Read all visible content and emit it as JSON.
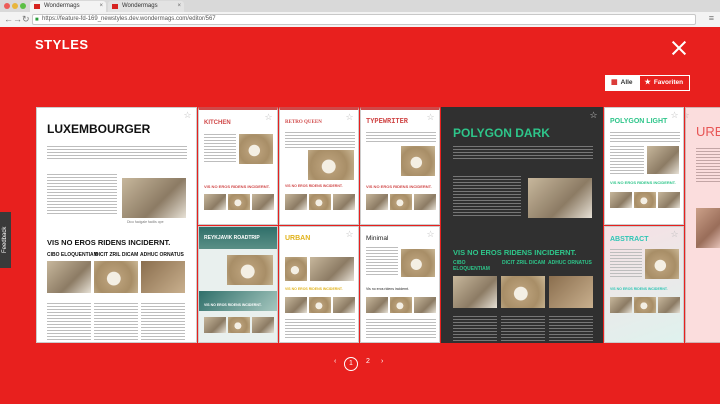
{
  "browser": {
    "tabs": [
      {
        "label": "Wondermags"
      },
      {
        "label": "Wondermags"
      }
    ],
    "url": "https://feature-fd-169_newstyles.dev.wondermags.com/editor/567"
  },
  "page": {
    "title": "STYLES",
    "filters": [
      {
        "label": "Alle",
        "icon": "grid-icon"
      },
      {
        "label": "Favoriten",
        "icon": "star-icon"
      }
    ],
    "feedback_label": "Feedback",
    "pagination": {
      "pages": [
        "1",
        "2"
      ],
      "current": "1"
    }
  },
  "styles": {
    "luxembourger": {
      "title": "LUXEMBOURGER",
      "heading": "VIS NO EROS RIDENS INCIDERNT.",
      "cols": [
        "CIBO ELOQUENTIAM",
        "DICIT ZRIL DICAM",
        "ADHUC ORNATUS"
      ],
      "caption": "Dico facigale facilis ope"
    },
    "kitchen": {
      "title": "KITCHEN",
      "heading": "VIS NO EROS RIDENS INCIDERNT."
    },
    "retro_queen": {
      "title": "RETRO QUEEN",
      "heading": "VIS NO EROS RIDENS INCIDERNT."
    },
    "typewriter": {
      "title": "TYPEWRITER",
      "heading": "VIS NO EROS RIDENS INCIDERNT."
    },
    "polygon_dark": {
      "title": "POLYGON DARK",
      "heading": "VIS NO EROS RIDENS INCIDERNT.",
      "cols": [
        "CIBO ELOQUENTIAM",
        "DICIT ZRIL DICAM",
        "ADHUC ORNATUS"
      ]
    },
    "polygon_light": {
      "title": "POLYGON LIGHT",
      "heading": "VIS NO EROS RIDENS INCIDERNT."
    },
    "urb": {
      "title": "URB"
    },
    "reykjavik": {
      "title": "REYKJAVIK ROADTRIP",
      "heading": "VIS NO EROS RIDENS INCIDERNT."
    },
    "urban": {
      "title": "URBAN",
      "heading": "VIS NO EROS RIDENS INCIDERNT."
    },
    "minimal": {
      "title": "Minimal",
      "heading": "Vis no eros ridens incidernt."
    },
    "abstract": {
      "title": "ABSTRACT",
      "heading": "VIS NO EROS RIDENS INCIDERNT."
    }
  },
  "colors": {
    "accent": "#e8201e",
    "polygon_green": "#2ec58a",
    "kitchen_red": "#d04848",
    "urban_yellow": "#e1b21a",
    "reykjavik_teal": "#2f6f6a"
  }
}
